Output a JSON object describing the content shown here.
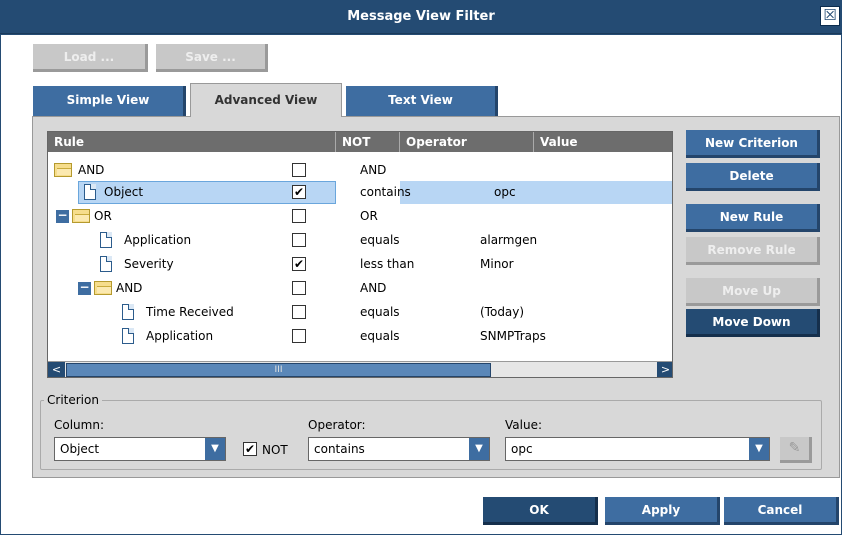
{
  "window": {
    "title": "Message View Filter",
    "close_glyph": "☒"
  },
  "top_buttons": {
    "load": "Load ...",
    "save": "Save ..."
  },
  "tabs": [
    {
      "label": "Simple View",
      "active": false
    },
    {
      "label": "Advanced View",
      "active": true
    },
    {
      "label": "Text View",
      "active": false
    }
  ],
  "grid": {
    "columns": [
      "Rule",
      "NOT",
      "Operator",
      "Value"
    ],
    "rows": [
      {
        "rule": "AND",
        "not": "",
        "operator": "AND",
        "value": "",
        "icon": "folder-icon",
        "level": 0,
        "expander": ""
      },
      {
        "rule": "Object",
        "not": "✔",
        "operator": "contains",
        "value": "opc",
        "icon": "document-icon",
        "level": 1,
        "selected": true
      },
      {
        "rule": "OR",
        "not": "",
        "operator": "OR",
        "value": "",
        "icon": "folder-icon",
        "level": 0,
        "expander": "−"
      },
      {
        "rule": "Application",
        "not": "",
        "operator": "equals",
        "value": "alarmgen",
        "icon": "document-icon",
        "level": 2
      },
      {
        "rule": "Severity",
        "not": "✔",
        "operator": "less than",
        "value": "Minor",
        "icon": "document-icon",
        "level": 2
      },
      {
        "rule": "AND",
        "not": "",
        "operator": "AND",
        "value": "",
        "icon": "folder-icon",
        "level": 1,
        "expander": "−"
      },
      {
        "rule": "Time Received",
        "not": "",
        "operator": "equals",
        "value": "(Today)",
        "icon": "document-icon",
        "level": 3
      },
      {
        "rule": "Application",
        "not": "",
        "operator": "equals",
        "value": "SNMPTraps",
        "icon": "document-icon",
        "level": 3
      }
    ],
    "scroll_thumb_glyph": "III",
    "scroll_left_glyph": "<",
    "scroll_right_glyph": ">"
  },
  "side_buttons": {
    "new_criterion": "New Criterion",
    "delete": "Delete",
    "new_rule": "New Rule",
    "remove_rule": "Remove Rule",
    "move_up": "Move Up",
    "move_down": "Move Down"
  },
  "criterion": {
    "legend": "Criterion",
    "column_label": "Column:",
    "column_value": "Object",
    "not_label": "NOT",
    "not_checked": "✔",
    "operator_label": "Operator:",
    "operator_value": "contains",
    "value_label": "Value:",
    "value_value": "opc",
    "dropdown_glyph": "▼",
    "picker_glyph": "✎"
  },
  "bottom_buttons": {
    "ok": "OK",
    "apply": "Apply",
    "cancel": "Cancel"
  },
  "colors": {
    "accent": "#244b73",
    "button": "#3e6da1",
    "selection": "#b8d6f4",
    "panel": "#d8d8d8"
  }
}
